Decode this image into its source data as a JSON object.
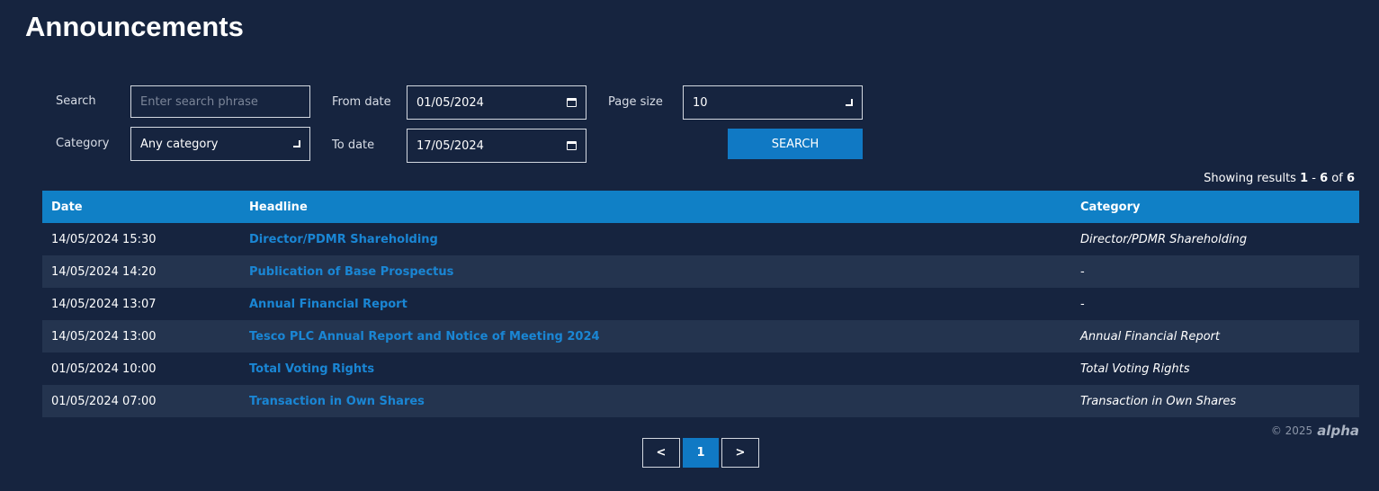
{
  "page": {
    "title": "Announcements"
  },
  "filters": {
    "search_label": "Search",
    "search_placeholder": "Enter search phrase",
    "from_date_label": "From date",
    "from_date_value": "01/05/2024",
    "page_size_label": "Page size",
    "page_size_value": "10",
    "category_label": "Category",
    "category_value": "Any category",
    "to_date_label": "To date",
    "to_date_value": "17/05/2024",
    "search_button": "SEARCH"
  },
  "results": {
    "prefix": "Showing results ",
    "from": "1",
    "sep": " - ",
    "to": "6",
    "of": " of ",
    "total": "6"
  },
  "table": {
    "headers": [
      "Date",
      "Headline",
      "Category"
    ],
    "rows": [
      {
        "date": "14/05/2024 15:30",
        "headline": "Director/PDMR Shareholding",
        "category": "Director/PDMR Shareholding"
      },
      {
        "date": "14/05/2024 14:20",
        "headline": "Publication of Base Prospectus",
        "category": "-"
      },
      {
        "date": "14/05/2024 13:07",
        "headline": "Annual Financial Report",
        "category": "-"
      },
      {
        "date": "14/05/2024 13:00",
        "headline": "Tesco PLC Annual Report and Notice of Meeting 2024",
        "category": "Annual Financial Report"
      },
      {
        "date": "01/05/2024 10:00",
        "headline": "Total Voting Rights",
        "category": "Total Voting Rights"
      },
      {
        "date": "01/05/2024 07:00",
        "headline": "Transaction in Own Shares",
        "category": "Transaction in Own Shares"
      }
    ]
  },
  "footer": {
    "copyright": "© 2025",
    "brand": "alpha"
  },
  "pagination": {
    "prev": "<",
    "current": "1",
    "next": ">"
  },
  "colors": {
    "background": "#16243f",
    "accent": "#1080c6",
    "link": "#1a86d4",
    "alt_row": "#24344f"
  }
}
